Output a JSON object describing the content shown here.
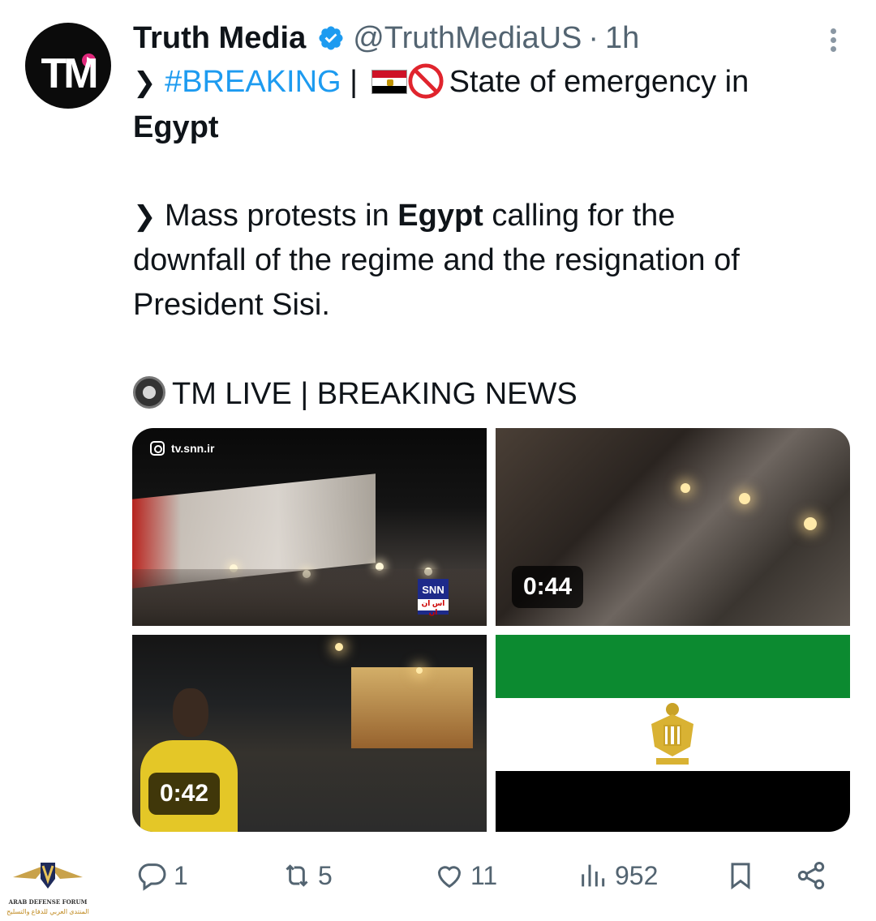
{
  "tweet": {
    "avatar_text": "TM",
    "author_name": "Truth Media",
    "handle": "@TruthMediaUS",
    "separator": "·",
    "time": "1h",
    "line1_chevron": "❯",
    "hashtag": "#BREAKING",
    "line1_pipe": " |",
    "line1_text": "State of emergency in",
    "line2_bold": "Egypt",
    "para2_chevron": "❯",
    "para2_a": " Mass protests in ",
    "para2_bold": "Egypt",
    "para2_b": " calling for the",
    "para2_line2": "downfall of the regime and the resignation of",
    "para2_line3": "President Sisi.",
    "live_line": "TM LIVE | BREAKING NEWS"
  },
  "media": {
    "item1": {
      "watermark_handle": "tv.snn.ir",
      "logo_text": "SNN",
      "logo_sub": "اس ان ان"
    },
    "item2": {
      "duration": "0:44"
    },
    "item3": {
      "duration": "0:42"
    },
    "item4": {
      "flag_colors": [
        "#0c8a30",
        "#ffffff",
        "#000000"
      ]
    }
  },
  "actions": {
    "replies": "1",
    "reposts": "5",
    "likes": "11",
    "views": "952"
  },
  "watermark": {
    "brand_line": "ARAB DEFENSE FORUM",
    "brand_arabic": "المنتدى العربي للدفاع والتسليح"
  },
  "colors": {
    "accent": "#1d9bf0",
    "muted": "#536471",
    "text": "#0f1419"
  }
}
